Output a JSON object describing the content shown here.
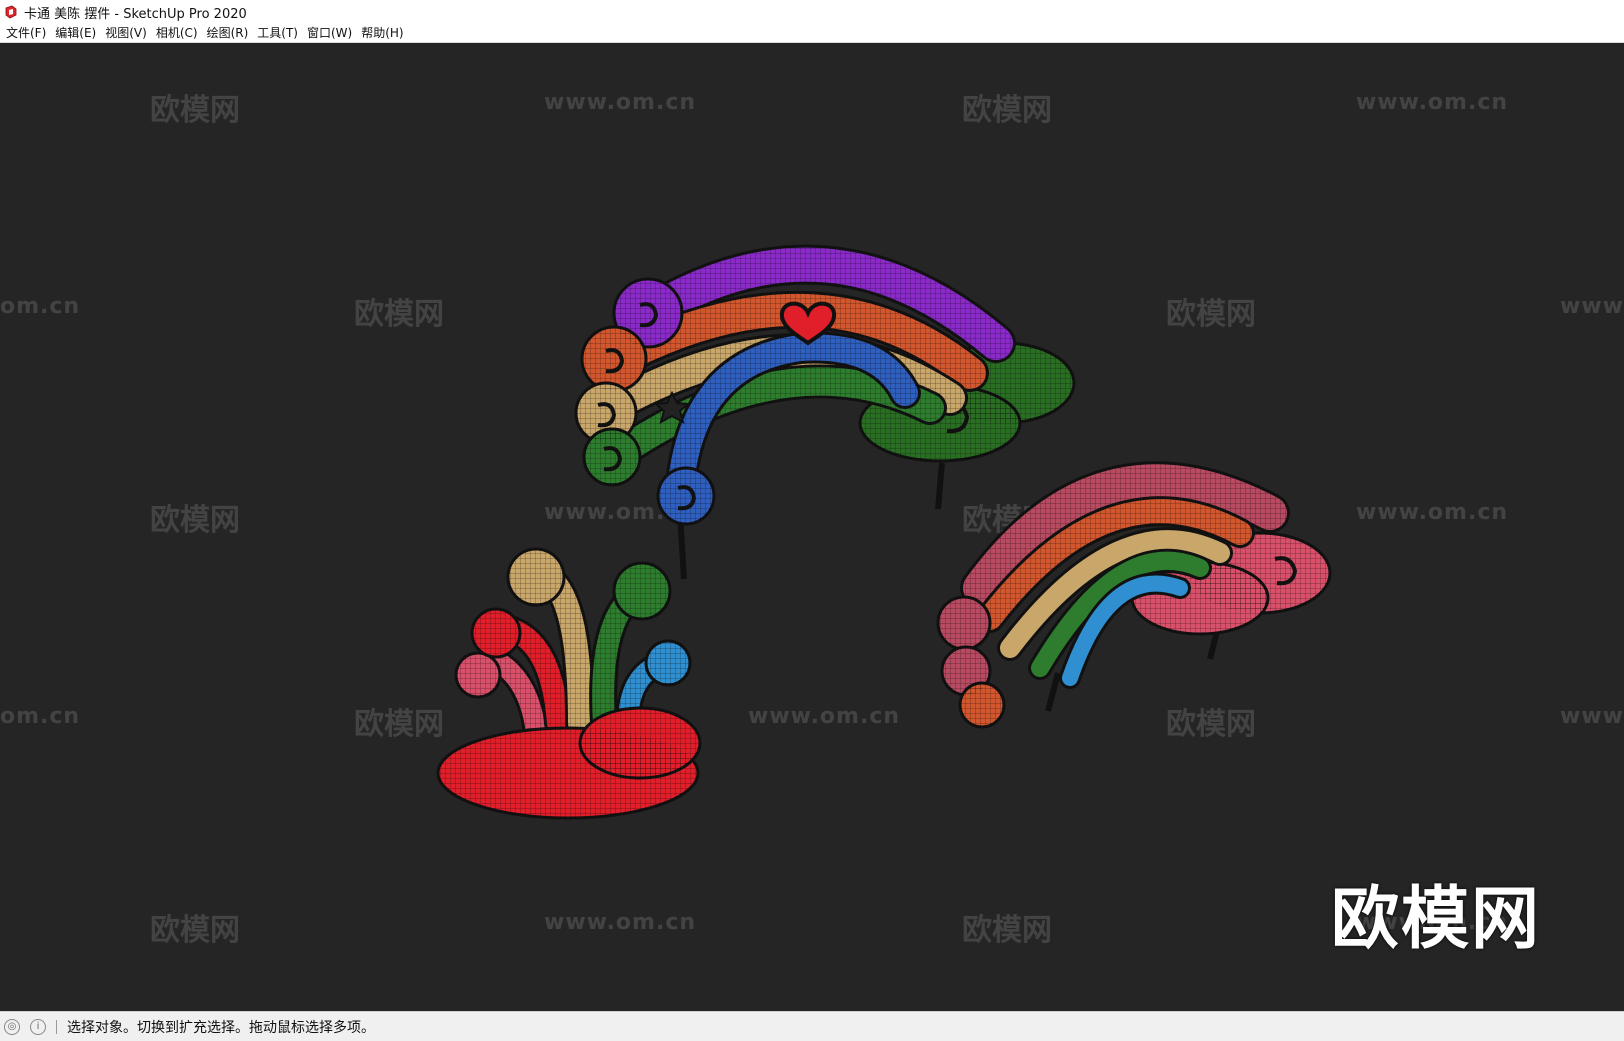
{
  "window": {
    "title": "卡通 美陈 摆件 - SketchUp Pro 2020"
  },
  "menu": {
    "items": [
      "文件(F)",
      "编辑(E)",
      "视图(V)",
      "相机(C)",
      "绘图(R)",
      "工具(T)",
      "窗口(W)",
      "帮助(H)"
    ]
  },
  "watermarks": {
    "brand": "欧模网",
    "url": "www.om.cn",
    "url_partial_left": "om.cn",
    "url_partial_right": "www.",
    "big_logo": "欧模网"
  },
  "statusbar": {
    "text": "选择对象。切换到扩充选择。拖动鼠标选择多项。",
    "icons": [
      "geo-location-icon",
      "info-icon"
    ]
  },
  "colors": {
    "viewport_bg": "#252525",
    "purple": "#8a2bc9",
    "orange": "#d2572e",
    "tan": "#c9a66a",
    "green": "#2e7d2e",
    "blue": "#2f5fbf",
    "red": "#e01f2b",
    "pink": "#d9506a"
  }
}
